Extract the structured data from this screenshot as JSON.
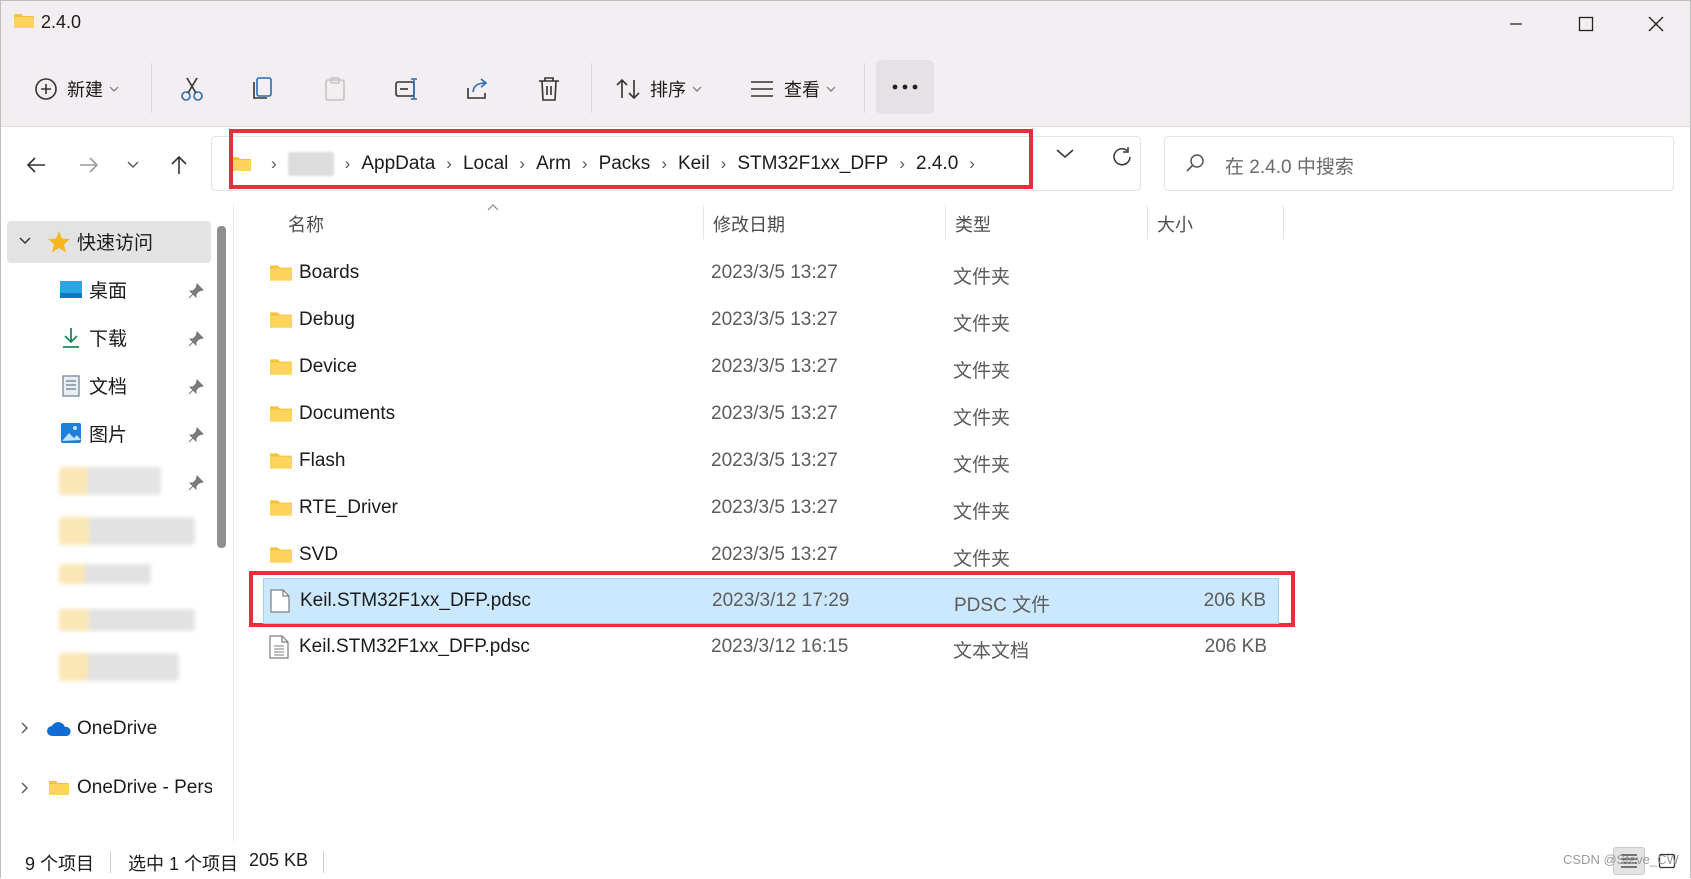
{
  "window": {
    "title": "2.4.0"
  },
  "toolbar": {
    "new_label": "新建",
    "sort_label": "排序",
    "view_label": "查看",
    "more_label": "···"
  },
  "address": {
    "crumbs": [
      "AppData",
      "Local",
      "Arm",
      "Packs",
      "Keil",
      "STM32F1xx_DFP",
      "2.4.0"
    ]
  },
  "search": {
    "placeholder": "在 2.4.0 中搜索"
  },
  "sidebar": {
    "quick_access": "快速访问",
    "items": [
      {
        "label": "桌面",
        "icon": "desktop-icon"
      },
      {
        "label": "下载",
        "icon": "download-icon"
      },
      {
        "label": "文档",
        "icon": "document-icon"
      },
      {
        "label": "图片",
        "icon": "pictures-icon"
      }
    ],
    "onedrive": "OneDrive",
    "onedrive_personal": "OneDrive - Pers"
  },
  "columns": {
    "name": "名称",
    "date": "修改日期",
    "type": "类型",
    "size": "大小"
  },
  "files": [
    {
      "name": "Boards",
      "date": "2023/3/5 13:27",
      "type": "文件夹",
      "size": "",
      "icon": "folder-icon"
    },
    {
      "name": "Debug",
      "date": "2023/3/5 13:27",
      "type": "文件夹",
      "size": "",
      "icon": "folder-icon"
    },
    {
      "name": "Device",
      "date": "2023/3/5 13:27",
      "type": "文件夹",
      "size": "",
      "icon": "folder-icon"
    },
    {
      "name": "Documents",
      "date": "2023/3/5 13:27",
      "type": "文件夹",
      "size": "",
      "icon": "folder-icon"
    },
    {
      "name": "Flash",
      "date": "2023/3/5 13:27",
      "type": "文件夹",
      "size": "",
      "icon": "folder-icon"
    },
    {
      "name": "RTE_Driver",
      "date": "2023/3/5 13:27",
      "type": "文件夹",
      "size": "",
      "icon": "folder-icon"
    },
    {
      "name": "SVD",
      "date": "2023/3/5 13:27",
      "type": "文件夹",
      "size": "",
      "icon": "folder-icon"
    },
    {
      "name": "Keil.STM32F1xx_DFP.pdsc",
      "date": "2023/3/12 17:29",
      "type": "PDSC 文件",
      "size": "206 KB",
      "icon": "file-icon",
      "selected": true
    },
    {
      "name": "Keil.STM32F1xx_DFP.pdsc",
      "date": "2023/3/12 16:15",
      "type": "文本文档",
      "size": "206 KB",
      "icon": "text-file-icon"
    }
  ],
  "status": {
    "count": "9 个项目",
    "selection": "选中 1 个项目",
    "size": "205 KB"
  },
  "watermark": "CSDN @Steve_CW",
  "colors": {
    "highlight": "#e8303c",
    "selection": "#cce8ff",
    "folder": "#ffc83d"
  }
}
